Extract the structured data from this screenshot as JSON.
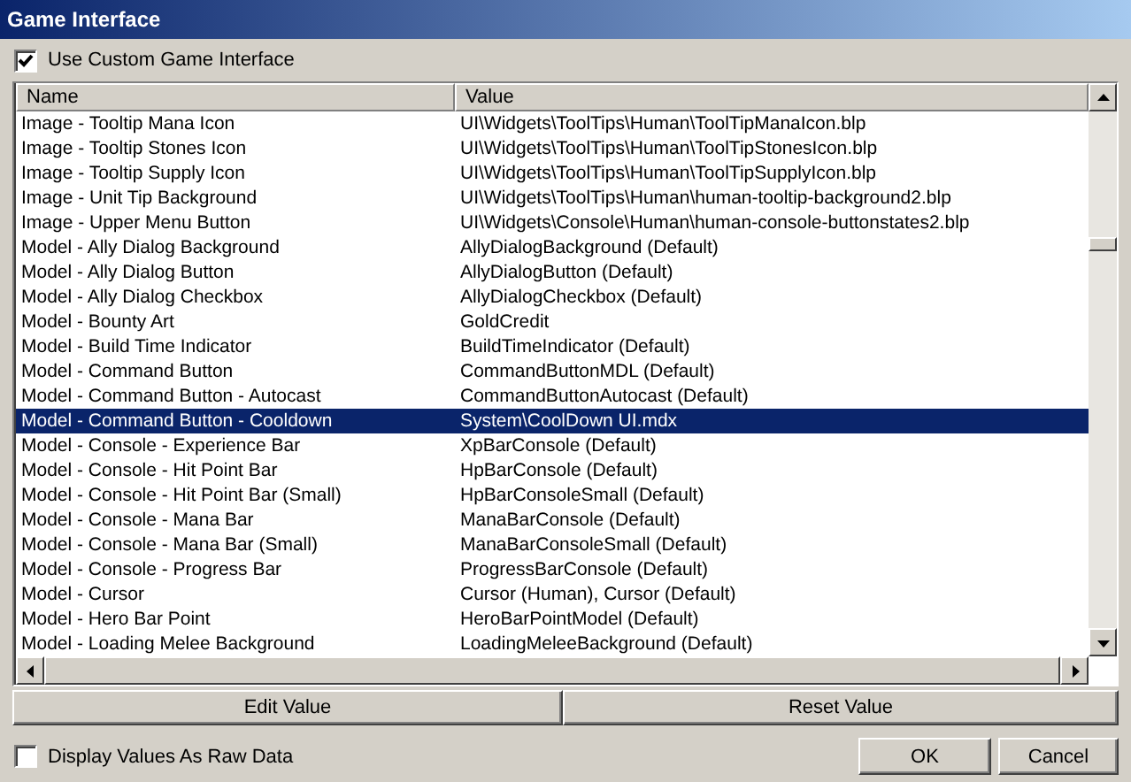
{
  "window": {
    "title": "Game Interface"
  },
  "use_custom": {
    "label": "Use Custom Game Interface",
    "checked": true
  },
  "table": {
    "columns": [
      "Name",
      "Value"
    ],
    "rows": [
      {
        "name": "Image - Tooltip Mana Icon",
        "value": "UI\\Widgets\\ToolTips\\Human\\ToolTipManaIcon.blp",
        "selected": false
      },
      {
        "name": "Image - Tooltip Stones Icon",
        "value": "UI\\Widgets\\ToolTips\\Human\\ToolTipStonesIcon.blp",
        "selected": false
      },
      {
        "name": "Image - Tooltip Supply Icon",
        "value": "UI\\Widgets\\ToolTips\\Human\\ToolTipSupplyIcon.blp",
        "selected": false
      },
      {
        "name": "Image - Unit Tip Background",
        "value": "UI\\Widgets\\ToolTips\\Human\\human-tooltip-background2.blp",
        "selected": false
      },
      {
        "name": "Image - Upper Menu Button",
        "value": "UI\\Widgets\\Console\\Human\\human-console-buttonstates2.blp",
        "selected": false
      },
      {
        "name": "Model - Ally Dialog Background",
        "value": "AllyDialogBackground (Default)",
        "selected": false
      },
      {
        "name": "Model - Ally Dialog Button",
        "value": "AllyDialogButton (Default)",
        "selected": false
      },
      {
        "name": "Model - Ally Dialog Checkbox",
        "value": "AllyDialogCheckbox (Default)",
        "selected": false
      },
      {
        "name": "Model - Bounty Art",
        "value": "GoldCredit",
        "selected": false
      },
      {
        "name": "Model - Build Time Indicator",
        "value": "BuildTimeIndicator (Default)",
        "selected": false
      },
      {
        "name": "Model - Command Button",
        "value": "CommandButtonMDL (Default)",
        "selected": false
      },
      {
        "name": "Model - Command Button - Autocast",
        "value": "CommandButtonAutocast (Default)",
        "selected": false
      },
      {
        "name": "Model - Command Button - Cooldown",
        "value": "System\\CoolDown UI.mdx",
        "selected": true
      },
      {
        "name": "Model - Console - Experience Bar",
        "value": "XpBarConsole (Default)",
        "selected": false
      },
      {
        "name": "Model - Console - Hit Point Bar",
        "value": "HpBarConsole (Default)",
        "selected": false
      },
      {
        "name": "Model - Console - Hit Point Bar (Small)",
        "value": "HpBarConsoleSmall (Default)",
        "selected": false
      },
      {
        "name": "Model - Console - Mana Bar",
        "value": "ManaBarConsole (Default)",
        "selected": false
      },
      {
        "name": "Model - Console - Mana Bar (Small)",
        "value": "ManaBarConsoleSmall (Default)",
        "selected": false
      },
      {
        "name": "Model - Console - Progress Bar",
        "value": "ProgressBarConsole (Default)",
        "selected": false
      },
      {
        "name": "Model - Cursor",
        "value": "Cursor (Human), Cursor (Default)",
        "selected": false
      },
      {
        "name": "Model - Hero Bar Point",
        "value": "HeroBarPointModel (Default)",
        "selected": false
      },
      {
        "name": "Model - Loading Melee Background",
        "value": "LoadingMeleeBackground (Default)",
        "selected": false
      }
    ]
  },
  "actions": [
    "Edit Value",
    "Reset Value"
  ],
  "raw_data": {
    "label": "Display Values As Raw Data",
    "checked": false
  },
  "buttons": [
    "OK",
    "Cancel"
  ]
}
